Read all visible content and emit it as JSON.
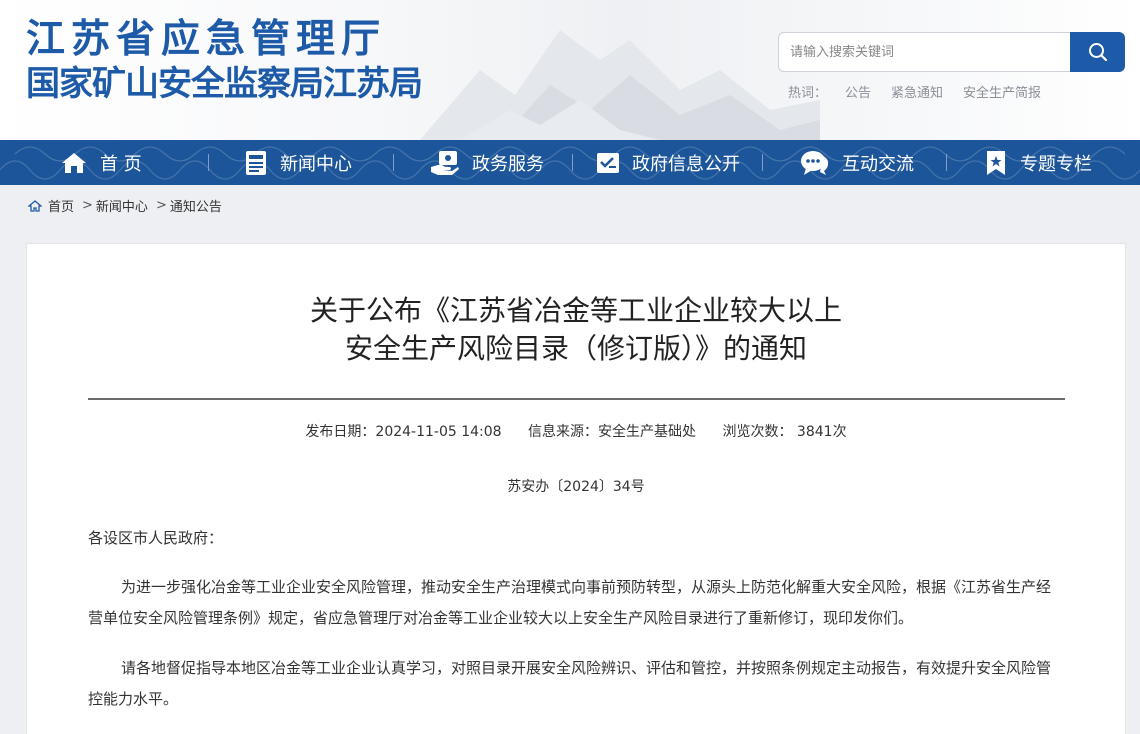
{
  "header": {
    "logo_line1": "江苏省应急管理厅",
    "logo_line2": "国家矿山安全监察局江苏局",
    "search_placeholder": "请输入搜索关键词",
    "hot_label": "热词：",
    "hot_words": [
      "公告",
      "紧急通知",
      "安全生产简报"
    ]
  },
  "nav": {
    "items": [
      {
        "label": "首 页",
        "icon": "home-icon"
      },
      {
        "label": "新闻中心",
        "icon": "news-icon"
      },
      {
        "label": "政务服务",
        "icon": "service-icon"
      },
      {
        "label": "政府信息公开",
        "icon": "info-open-icon"
      },
      {
        "label": "互动交流",
        "icon": "chat-icon"
      },
      {
        "label": "专题专栏",
        "icon": "bookmark-icon"
      }
    ]
  },
  "breadcrumb": {
    "home": "首页",
    "level1": "新闻中心",
    "level2": "通知公告"
  },
  "article": {
    "title_line1": "关于公布《江苏省冶金等工业企业较大以上",
    "title_line2": "安全生产风险目录（修订版）》的通知",
    "publish_date": "发布日期：2024-11-05 14:08",
    "source": "信息来源：安全生产基础处",
    "views": "浏览次数： 3841次",
    "doc_number": "苏安办〔2024〕34号",
    "salutation": "各设区市人民政府：",
    "paragraph1": "为进一步强化冶金等工业企业安全风险管理，推动安全生产治理模式向事前预防转型，从源头上防范化解重大安全风险，根据《江苏省生产经营单位安全风险管理条例》规定，省应急管理厅对冶金等工业企业较大以上安全生产风险目录进行了重新修订，现印发你们。",
    "paragraph2": "请各地督促指导本地区冶金等工业企业认真学习，对照目录开展安全风险辨识、评估和管控，并按照条例规定主动报告，有效提升安全风险管控能力水平。"
  },
  "colors": {
    "brand_blue": "#1d5aa8",
    "nav_blue": "#1c5599"
  }
}
